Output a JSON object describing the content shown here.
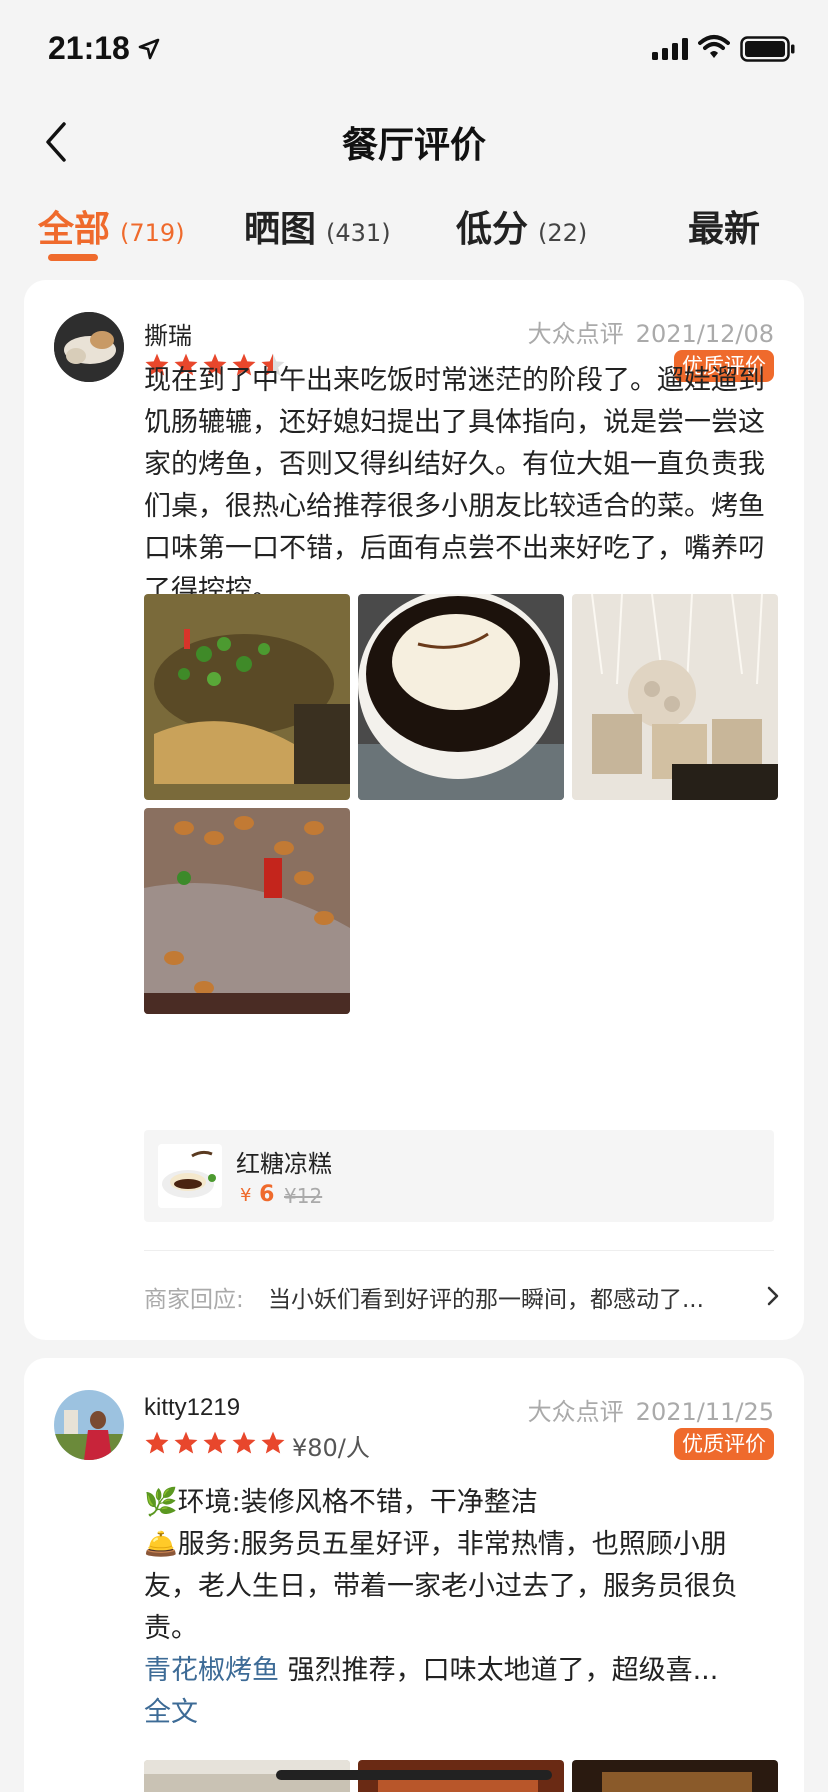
{
  "status_bar": {
    "time": "21:18"
  },
  "header": {
    "title": "餐厅评价"
  },
  "tabs": [
    {
      "label": "全部",
      "count": "(719)",
      "active": true
    },
    {
      "label": "晒图",
      "count": "(431)",
      "active": false
    },
    {
      "label": "低分",
      "count": "(22)",
      "active": false
    },
    {
      "label": "最新",
      "count": "",
      "active": false
    }
  ],
  "reviews": [
    {
      "user": "撕瑞",
      "rating": 4.5,
      "source": "大众点评",
      "date": "2021/12/08",
      "badge": "优质评价",
      "text": "现在到了中午出来吃饭时常迷茫的阶段了。遛娃遛到饥肠辘辘，还好媳妇提出了具体指向，说是尝一尝这家的烤鱼，否则又得纠结好久。有位大姐一直负责我们桌，很热心给推荐很多小朋友比较适合的菜。烤鱼口味第一口不错，后面有点尝不出来好吃了，嘴养叼了得控控。",
      "photos": 4,
      "product": {
        "name": "红糖凉糕",
        "currency": "¥",
        "price": "6",
        "original_price": "¥12"
      },
      "merchant_reply_label": "商家回应:",
      "merchant_reply": "当小妖们看到好评的那一瞬间，都感动了..."
    },
    {
      "user": "kitty1219",
      "rating": 5,
      "price_per_person": "¥80/人",
      "source": "大众点评",
      "date": "2021/11/25",
      "badge": "优质评价",
      "line1_emoji": "🌿",
      "line1": "环境:装修风格不错，干净整洁",
      "line2_emoji": "🛎️",
      "line2": "服务:服务员五星好评，非常热情，也照顾小朋友，老人生日，带着一家老小过去了，服务员很负责。",
      "dish": "青花椒烤鱼",
      "line3": "强烈推荐，口味太地道了，超级喜...",
      "full_text_label": "全文"
    }
  ],
  "colors": {
    "accent": "#ef6a2c",
    "star": "#e8472c",
    "link": "#3d6b96"
  }
}
